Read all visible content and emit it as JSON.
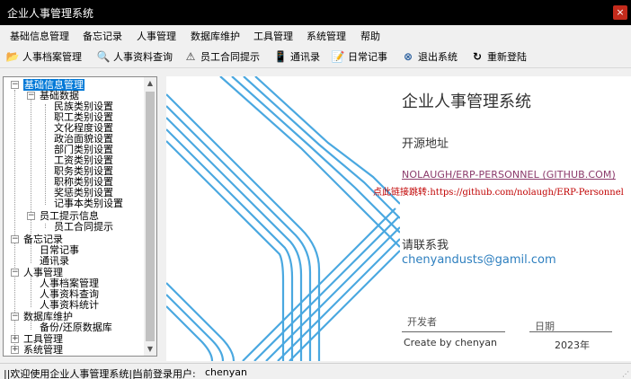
{
  "window": {
    "title": "企业人事管理系统",
    "close_glyph": "×"
  },
  "menu": [
    "基础信息管理",
    "备忘记录",
    "人事管理",
    "数据库维护",
    "工具管理",
    "系统管理",
    "帮助"
  ],
  "toolbar": [
    {
      "label": "人事档案管理",
      "icon": "folder-open-icon",
      "glyph": "📂"
    },
    {
      "label": "人事资料查询",
      "icon": "magnifier-icon",
      "glyph": "🔍"
    },
    {
      "label": "员工合同提示",
      "icon": "warning-icon",
      "glyph": "⚠"
    },
    {
      "label": "通讯录",
      "icon": "phone-icon",
      "glyph": "📱"
    },
    {
      "label": "日常记事",
      "icon": "notepad-icon",
      "glyph": "📝"
    },
    {
      "label": "退出系统",
      "icon": "exit-icon",
      "glyph": "⊗"
    },
    {
      "label": "重新登陆",
      "icon": "refresh-icon",
      "glyph": "↻"
    }
  ],
  "tree": {
    "root": "基础信息管理",
    "basic_data": "基础数据",
    "basic_items": [
      "民族类别设置",
      "职工类别设置",
      "文化程度设置",
      "政治面貌设置",
      "部门类别设置",
      "工资类别设置",
      "职务类别设置",
      "职称类别设置",
      "奖惩类别设置",
      "记事本类别设置"
    ],
    "emp_tips": "员工提示信息",
    "contract_tip": "员工合同提示",
    "memo": "备忘记录",
    "memo_items": [
      "日常记事",
      "通讯录"
    ],
    "hr": "人事管理",
    "hr_items": [
      "人事档案管理",
      "人事资料查询",
      "人事资料统计"
    ],
    "db": "数据库维护",
    "db_items": [
      "备份/还原数据库"
    ],
    "tools": "工具管理",
    "sys": "系统管理"
  },
  "main": {
    "title": "企业人事管理系统",
    "source_label": "开源地址",
    "repo_link": "NOLAUGH/ERP-PERSONNEL (GITHUB.COM)",
    "jump_text": "点此链接跳转:https://github.com/nolaugh/ERP-Personnel",
    "contact_label": "请联系我",
    "email": "chenyandusts@gamil.com",
    "developer_label": "开发者",
    "date_label": "日期",
    "creator": "Create by chenyan",
    "year": "2023年",
    "accent_color": "#4aa8e0"
  },
  "status": {
    "welcome": "||欢迎使用企业人事管理系统||",
    "current_user_label": "当前登录用户:",
    "current_user": "chenyan"
  }
}
